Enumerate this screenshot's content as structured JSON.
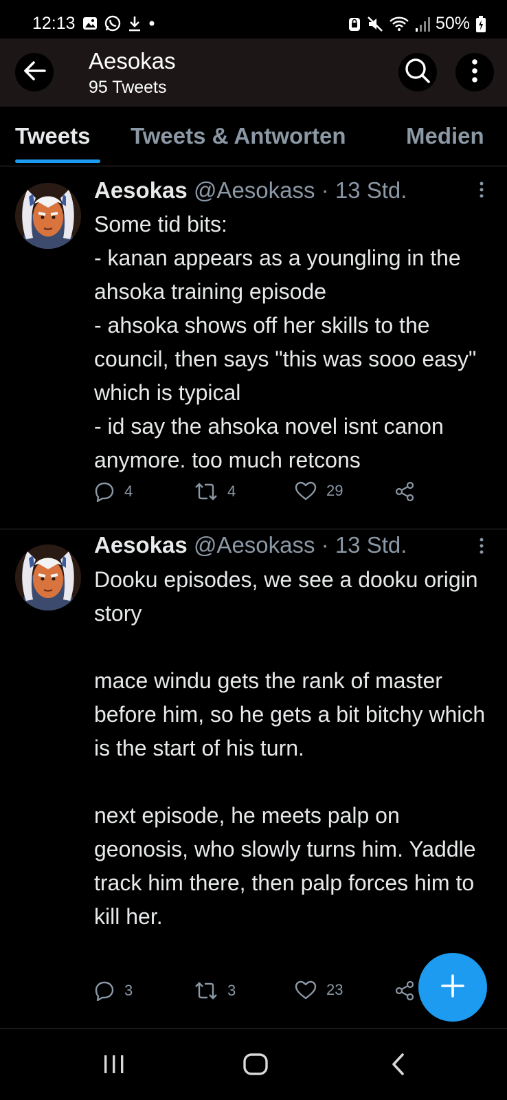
{
  "status_bar": {
    "time": "12:13",
    "battery": "50%",
    "icons_left": [
      "gallery-icon",
      "whatsapp-icon",
      "download-icon",
      "dot-icon"
    ],
    "icons_right": [
      "android-lock-icon",
      "mute-icon",
      "wifi-icon",
      "signal-icon",
      "battery-icon"
    ]
  },
  "header": {
    "title": "Aesokas",
    "subtitle": "95 Tweets",
    "back_icon": "arrow-left-icon",
    "search_icon": "search-icon",
    "more_icon": "more-vertical-icon"
  },
  "tabs": [
    {
      "label": "Tweets",
      "active": true
    },
    {
      "label": "Tweets & Antworten",
      "active": false
    },
    {
      "label": "Medien",
      "active": false
    }
  ],
  "tweets": [
    {
      "name": "Aesokas",
      "meta": "@Aesokass · 13 Std.",
      "body": "Some tid bits:\n- kanan appears as a youngling in the ahsoka training episode\n- ahsoka shows off her skills to the council, then says \"this was sooo easy\" which is typical\n- id say the ahsoka novel isnt canon anymore. too much retcons",
      "replies": "4",
      "retweets": "4",
      "likes": "29"
    },
    {
      "name": "Aesokas",
      "meta": "@Aesokass · 13 Std.",
      "body": "Dooku episodes, we see a dooku origin story\n\nmace windu gets the rank of master before him, so he gets a bit bitchy which is the start of his turn.\n\nnext episode, he meets palp on geonosis, who slowly turns him. Yaddle track him there, then palp forces him to kill her.",
      "replies": "3",
      "retweets": "3",
      "likes": "23"
    }
  ],
  "colors": {
    "accent": "#1d9bf0",
    "background": "#000000",
    "header_bg": "#1c1616",
    "text_primary": "#e7e9ea",
    "text_secondary": "#8b98a5",
    "divider": "#2f3336"
  },
  "fab_icon": "plus-icon",
  "nav_bar": [
    "recent-apps-icon",
    "home-icon",
    "back-icon"
  ]
}
